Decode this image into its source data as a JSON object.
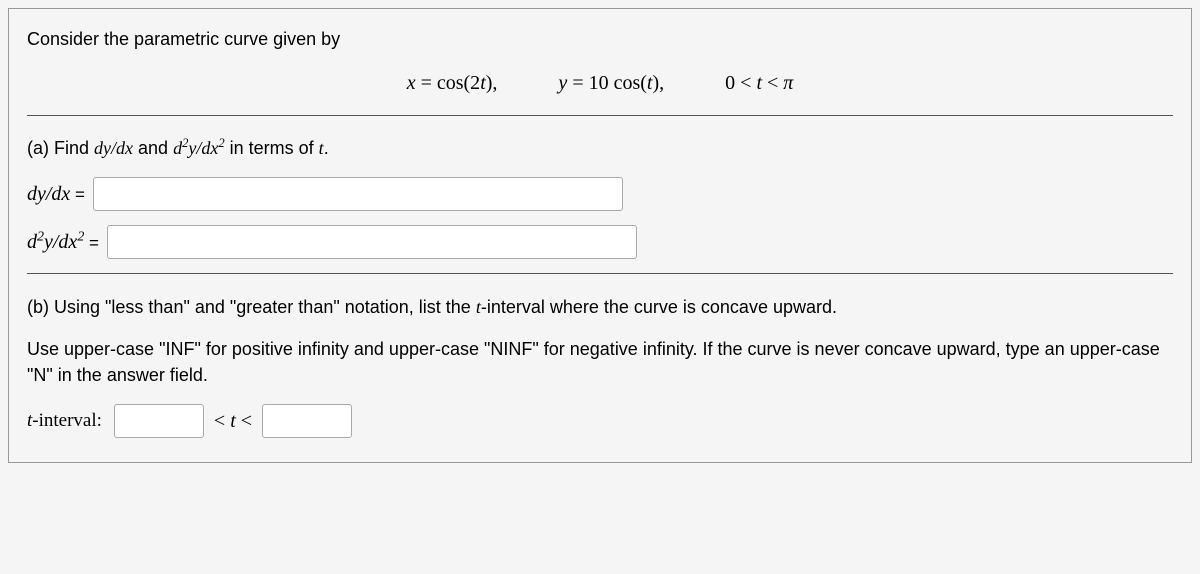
{
  "intro": "Consider the parametric curve given by",
  "equations": {
    "eq1": "x = cos(2t),",
    "eq2": "y = 10 cos(t),",
    "eq3": "0 < t < π"
  },
  "part_a": {
    "prompt_pre": "(a) Find ",
    "dydx": "dy/dx",
    "and": " and ",
    "d2ydx2_pre": "d",
    "d2ydx2_sup1": "2",
    "d2ydx2_mid": "y/dx",
    "d2ydx2_sup2": "2",
    "prompt_post": " in terms of ",
    "var_t": "t",
    "period": ".",
    "label1": "dy/dx",
    "eq_sign": " =",
    "label2_pre": "d",
    "label2_sup1": "2",
    "label2_mid": "y/dx",
    "label2_sup2": "2"
  },
  "part_b": {
    "line1_pre": "(b) Using \"less than\" and \"greater than\" notation, list the ",
    "line1_var": "t",
    "line1_post": "-interval where the curve is concave upward.",
    "line2": "Use upper-case \"INF\" for positive infinity and upper-case \"NINF\" for negative infinity. If the curve is never concave upward, type an upper-case \"N\" in the answer field.",
    "interval_label_var": "t",
    "interval_label_post": "-interval:",
    "interval_mid": "< t <"
  }
}
